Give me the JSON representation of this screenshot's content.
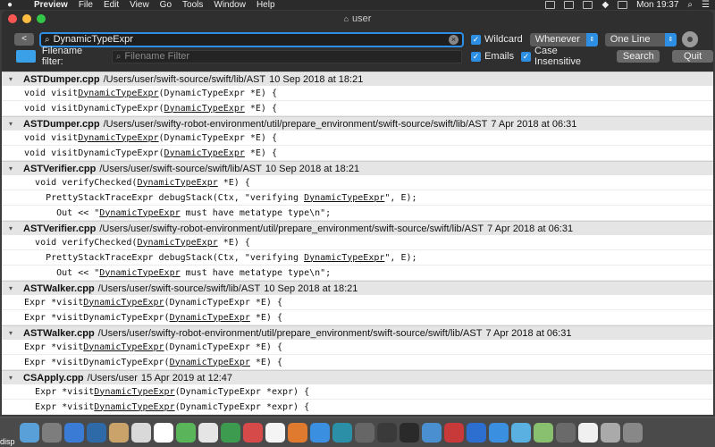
{
  "menubar": {
    "app": "Preview",
    "items": [
      "File",
      "Edit",
      "View",
      "Go",
      "Tools",
      "Window",
      "Help"
    ],
    "clock": "Mon 19:37"
  },
  "window": {
    "title": "user"
  },
  "toolbar": {
    "back_label": "<",
    "search_value": "DynamicTypeExpr",
    "wildcard_label": "Wildcard",
    "mode_value": "Whenever",
    "display_value": "One Line",
    "filename_filter_label": "Filename filter:",
    "filename_filter_placeholder": "Filename Filter",
    "emails_label": "Emails",
    "case_label": "Case Insensitive",
    "search_button": "Search",
    "quit_button": "Quit"
  },
  "results": [
    {
      "file": "ASTDumper.cpp",
      "path": "/Users/user/swift-source/swift/lib/AST",
      "date": "10 Sep 2018 at 18:21",
      "lines": [
        {
          "indent": "",
          "pre": "void visit",
          "match": "DynamicTypeExpr",
          "post": "(DynamicTypeExpr *E) {"
        },
        {
          "indent": "",
          "pre": "void visitDynamicTypeExpr(",
          "match": "DynamicTypeExpr",
          "post": " *E) {"
        }
      ]
    },
    {
      "file": "ASTDumper.cpp",
      "path": "/Users/user/swifty-robot-environment/util/prepare_environment/swift-source/swift/lib/AST",
      "date": "7 Apr 2018 at 06:31",
      "lines": [
        {
          "indent": "",
          "pre": "void visit",
          "match": "DynamicTypeExpr",
          "post": "(DynamicTypeExpr *E) {"
        },
        {
          "indent": "",
          "pre": "void visitDynamicTypeExpr(",
          "match": "DynamicTypeExpr",
          "post": " *E) {"
        }
      ]
    },
    {
      "file": "ASTVerifier.cpp",
      "path": "/Users/user/swift-source/swift/lib/AST",
      "date": "10 Sep 2018 at 18:21",
      "lines": [
        {
          "indent": "  ",
          "pre": "void verifyChecked(",
          "match": "DynamicTypeExpr",
          "post": " *E) {"
        },
        {
          "indent": "    ",
          "pre": "PrettyStackTraceExpr debugStack(Ctx, \"verifying ",
          "match": "DynamicTypeExpr",
          "post": "\", E);"
        },
        {
          "indent": "      ",
          "pre": "Out << \"",
          "match": "DynamicTypeExpr",
          "post": " must have metatype type\\n\";"
        }
      ]
    },
    {
      "file": "ASTVerifier.cpp",
      "path": "/Users/user/swifty-robot-environment/util/prepare_environment/swift-source/swift/lib/AST",
      "date": "7 Apr 2018 at 06:31",
      "lines": [
        {
          "indent": "  ",
          "pre": "void verifyChecked(",
          "match": "DynamicTypeExpr",
          "post": " *E) {"
        },
        {
          "indent": "    ",
          "pre": "PrettyStackTraceExpr debugStack(Ctx, \"verifying ",
          "match": "DynamicTypeExpr",
          "post": "\", E);"
        },
        {
          "indent": "      ",
          "pre": "Out << \"",
          "match": "DynamicTypeExpr",
          "post": " must have metatype type\\n\";"
        }
      ]
    },
    {
      "file": "ASTWalker.cpp",
      "path": "/Users/user/swift-source/swift/lib/AST",
      "date": "10 Sep 2018 at 18:21",
      "lines": [
        {
          "indent": "",
          "pre": "Expr *visit",
          "match": "DynamicTypeExpr",
          "post": "(DynamicTypeExpr *E) {"
        },
        {
          "indent": "",
          "pre": "Expr *visitDynamicTypeExpr(",
          "match": "DynamicTypeExpr",
          "post": " *E) {"
        }
      ]
    },
    {
      "file": "ASTWalker.cpp",
      "path": "/Users/user/swifty-robot-environment/util/prepare_environment/swift-source/swift/lib/AST",
      "date": "7 Apr 2018 at 06:31",
      "lines": [
        {
          "indent": "",
          "pre": "Expr *visit",
          "match": "DynamicTypeExpr",
          "post": "(DynamicTypeExpr *E) {"
        },
        {
          "indent": "",
          "pre": "Expr *visitDynamicTypeExpr(",
          "match": "DynamicTypeExpr",
          "post": " *E) {"
        }
      ]
    },
    {
      "file": "CSApply.cpp",
      "path": "/Users/user",
      "date": "15 Apr 2019 at 12:47",
      "lines": [
        {
          "indent": "  ",
          "pre": "Expr *visit",
          "match": "DynamicTypeExpr",
          "post": "(DynamicTypeExpr *expr) {"
        },
        {
          "indent": "  ",
          "pre": "Expr *visit",
          "match": "DynamicTypeExpr",
          "post": "(DynamicTypeExpr *expr) {"
        }
      ]
    }
  ],
  "dock": {
    "partial_label": "disp"
  }
}
